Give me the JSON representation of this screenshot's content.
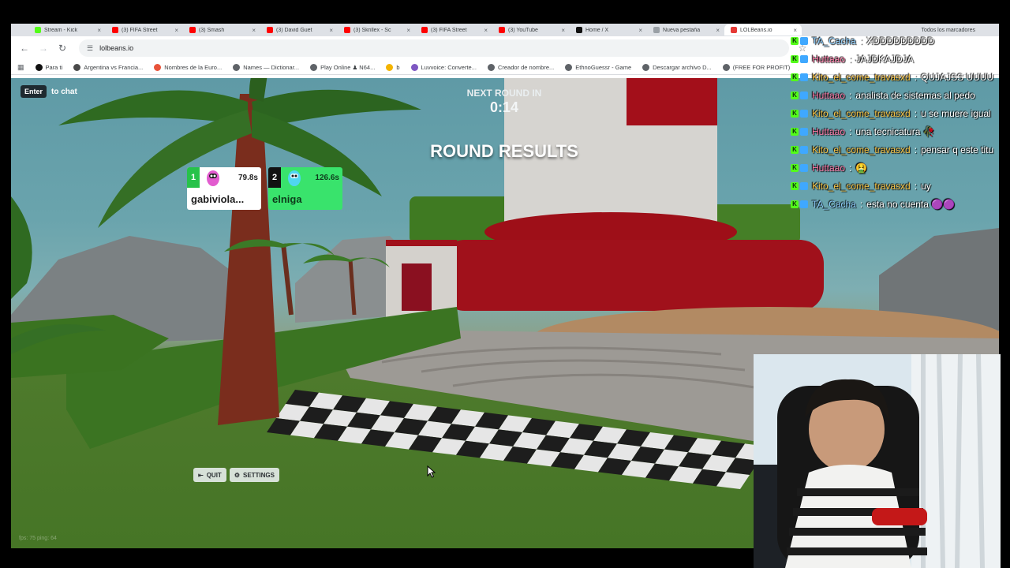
{
  "browser": {
    "tabs": [
      {
        "label": "Stream - Kick",
        "color": "#53fc18"
      },
      {
        "label": "(3) FIFA Street",
        "color": "#ff0000"
      },
      {
        "label": "(3) Smash",
        "color": "#ff0000"
      },
      {
        "label": "(3) David Guet",
        "color": "#ff0000"
      },
      {
        "label": "(3) Skrillex - Sc",
        "color": "#ff0000"
      },
      {
        "label": "(3) FIFA Street",
        "color": "#ff0000"
      },
      {
        "label": "(3) YouTube",
        "color": "#ff0000"
      },
      {
        "label": "Home / X",
        "color": "#111111"
      },
      {
        "label": "Nueva pestaña",
        "color": "#9aa0a6"
      },
      {
        "label": "LOLBeans.io",
        "color": "#e53935"
      }
    ],
    "url": "lolbeans.io",
    "bookmarks": [
      {
        "label": "Para ti",
        "color": "#111111"
      },
      {
        "label": "Argentina vs Francia...",
        "color": "#4a4a4a"
      },
      {
        "label": "Nombres de la Euro...",
        "color": "#e8533a"
      },
      {
        "label": "Names — Dictionar...",
        "color": "#5f6368"
      },
      {
        "label": "Play Online ♟ N64...",
        "color": "#5f6368"
      },
      {
        "label": "b",
        "color": "#f4b400"
      },
      {
        "label": "Luvvoice: Converte...",
        "color": "#7e57c2"
      },
      {
        "label": "Creador de nombre...",
        "color": "#5f6368"
      },
      {
        "label": "EthnoGuessr - Game",
        "color": "#5f6368"
      },
      {
        "label": "Descargar archivo D...",
        "color": "#5f6368"
      },
      {
        "label": "(FREE FOR PROFIT)",
        "color": "#5f6368"
      }
    ],
    "all_bookmarks": "Todos los marcadores"
  },
  "game": {
    "enter_key": "Enter",
    "enter_hint": "to chat",
    "next_round_label": "NEXT ROUND IN",
    "next_round_timer": "0:14",
    "round_results": "ROUND RESULTS",
    "results": [
      {
        "rank": "1",
        "time": "79.8s",
        "name": "gabiviola...",
        "avatar_color": "#e25ccf"
      },
      {
        "rank": "2",
        "time": "126.6s",
        "name": "elniga",
        "avatar_color": "#4fd6f0"
      }
    ],
    "quit_label": "QUIT",
    "settings_label": "SETTINGS",
    "fps_text": "fps: 75 ping: 64"
  },
  "chat": {
    "messages": [
      {
        "user": "TA_Cacha",
        "text": "XDDDDDDDDD",
        "color": "#8fd0ff"
      },
      {
        "user": "Huttaao",
        "text": "JAJDKAJDJA",
        "color": "#ff7aa8"
      },
      {
        "user": "Kito_el_come_travasxd",
        "text": "QUJAJSS UUUU",
        "color": "#f6c243"
      },
      {
        "user": "Huttaao",
        "text": "analista de sistemas al pedo",
        "color": "#ff7aa8"
      },
      {
        "user": "Kito_el_come_travasxd",
        "text": "u se muere igual",
        "color": "#f6c243"
      },
      {
        "user": "Huttaao",
        "text": "una tecnicatura 🥀",
        "color": "#ff7aa8"
      },
      {
        "user": "Kito_el_come_travasxd",
        "text": "pensar q este titu",
        "color": "#f6c243"
      },
      {
        "user": "Huttaao",
        "text": "🤮",
        "color": "#ff7aa8"
      },
      {
        "user": "Kito_el_come_travasxd",
        "text": "uy",
        "color": "#f6c243"
      },
      {
        "user": "TA_Cacha",
        "text": "esta no cuenta 🟣🟣",
        "color": "#8fd0ff"
      }
    ]
  },
  "colors": {
    "kick_green": "#53fc18",
    "first_place": "#27c24a",
    "second_card": "#39e36c"
  }
}
